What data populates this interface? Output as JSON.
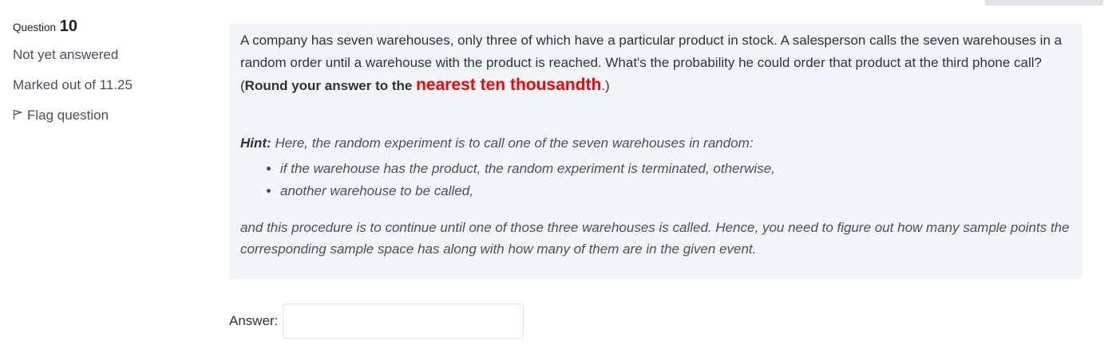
{
  "info": {
    "question_label": "Question",
    "question_number": "10",
    "status": "Not yet answered",
    "marks": "Marked out of 11.25",
    "flag_label": "Flag question"
  },
  "question": {
    "text_part1": "A company has seven warehouses, only three of which have a particular product in stock. A salesperson calls the seven warehouses in a random order until a warehouse with the product is reached. What's the probability he could order that product at the third phone call? (",
    "text_bold": "Round your answer to the ",
    "text_red": "nearest ten thousandth",
    "text_end": ".)"
  },
  "hint": {
    "label": "Hint:",
    "intro": " Here, the random experiment is to call one of the seven warehouses in random:",
    "bullets": [
      "if the warehouse has the product, the random experiment is terminated, otherwise,",
      "another warehouse to be called,"
    ],
    "conclusion": "and this procedure is to continue until one of those three warehouses is called. Hence, you need to figure out how many sample points the corresponding sample space has along with how many of them are in the given event."
  },
  "answer": {
    "label": "Answer:",
    "value": ""
  },
  "colors": {
    "highlight": "#ff0000",
    "panel_bg": "#f3f6f9"
  }
}
